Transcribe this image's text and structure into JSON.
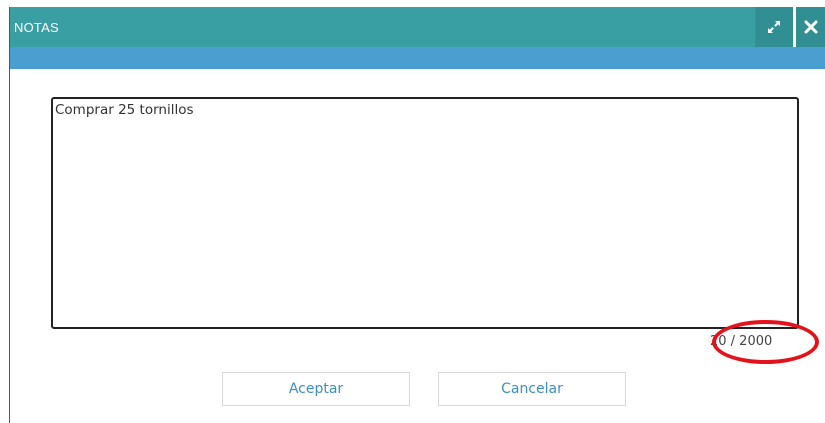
{
  "dialog": {
    "title": "NOTAS",
    "expand_icon": "expand-arrows-icon",
    "close_icon": "close-x-icon",
    "accent_color": "#3a9fa3",
    "subbar_color": "#4a9fd0"
  },
  "notes": {
    "value": "Comprar 25 tornillos",
    "counter": "20 / 2000"
  },
  "actions": {
    "accept_label": "Aceptar",
    "cancel_label": "Cancelar"
  },
  "annotation": {
    "highlight_color": "#e3121b"
  }
}
